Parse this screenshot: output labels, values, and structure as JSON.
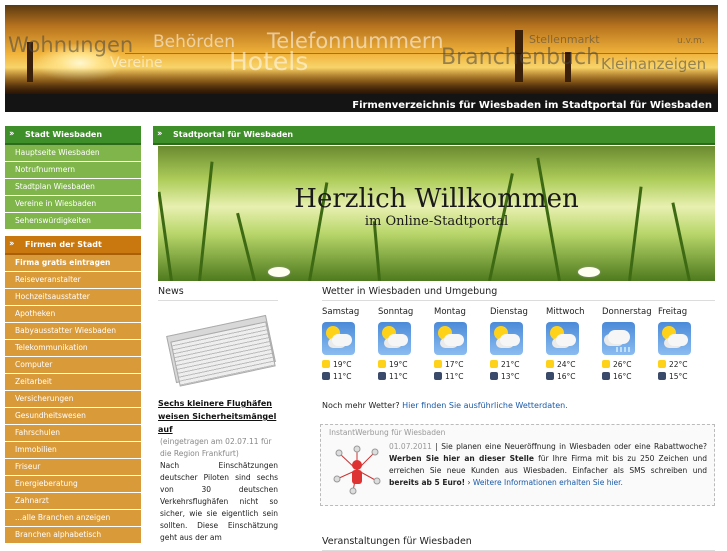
{
  "banner": {
    "words": [
      "Wohnungen",
      "Behörden",
      "Telefonnummern",
      "Vereine",
      "Hotels",
      "Branchenbuch",
      "Stellenmarkt",
      "u.v.m.",
      "Kleinanzeigen"
    ],
    "tagline": "Firmenverzeichnis für Wiesbaden im Stadtportal für Wiesbaden"
  },
  "sidebar": {
    "city": {
      "title": "Stadt Wiesbaden",
      "items": [
        "Hauptseite Wiesbaden",
        "Notrufnummern",
        "Stadtplan Wiesbaden",
        "Vereine in Wiesbaden",
        "Sehenswürdigkeiten"
      ]
    },
    "companies": {
      "title": "Firmen der Stadt",
      "items": [
        "Firma gratis eintragen",
        "Reiseveranstalter",
        "Hochzeitsausstatter",
        "Apotheken",
        "Babyausstatter Wiesbaden",
        "Telekommunikation",
        "Computer",
        "Zeitarbeit",
        "Versicherungen",
        "Gesundheitswesen",
        "Fahrschulen",
        "Immobilien",
        "Friseur",
        "Energieberatung",
        "Zahnarzt",
        "...alle Branchen anzeigen",
        "Branchen alphabetisch"
      ]
    }
  },
  "main": {
    "title": "Stadtportal für Wiesbaden",
    "hero_title": "Herzlich Willkommen",
    "hero_subtitle": "im Online-Stadtportal"
  },
  "news": {
    "title": "News",
    "headline": "Sechs kleinere Flughäfen weisen Sicherheitsmängel auf",
    "meta": "(eingetragen am 02.07.11 für die Region Frankfurt)",
    "body": "Nach Einschätzungen deutscher Piloten sind sechs von 30 deutschen Verkehrsflughäfen nicht so sicher, wie sie eigentlich sein sollten. Diese Einschätzung geht aus der am"
  },
  "weather": {
    "title": "Wetter in Wiesbaden und Umgebung",
    "days": [
      {
        "name": "Samstag",
        "icon": "sun-cloud-icon",
        "high": "19°C",
        "low": "11°C"
      },
      {
        "name": "Sonntag",
        "icon": "sun-cloud-icon",
        "high": "19°C",
        "low": "11°C"
      },
      {
        "name": "Montag",
        "icon": "sun-cloud-icon",
        "high": "17°C",
        "low": "11°C"
      },
      {
        "name": "Dienstag",
        "icon": "sun-cloud-icon",
        "high": "21°C",
        "low": "13°C"
      },
      {
        "name": "Mittwoch",
        "icon": "sun-cloud-icon",
        "high": "24°C",
        "low": "16°C"
      },
      {
        "name": "Donnerstag",
        "icon": "rain-cloud-icon",
        "high": "26°C",
        "low": "16°C"
      },
      {
        "name": "Freitag",
        "icon": "sun-cloud-icon",
        "high": "22°C",
        "low": "15°C"
      }
    ],
    "more_text": "Noch mehr Wetter?",
    "more_link": "Hier finden Sie ausführliche Wetterdaten."
  },
  "ad": {
    "label": "InstantWerbung für Wiesbaden",
    "date": "01.07.2011",
    "sep": " | ",
    "text1": "Sie planen eine Neueröffnung in Wiesbaden oder eine Rabattwoche?",
    "bold1": "Werben Sie hier an dieser Stelle",
    "text2": "für Ihre Firma mit bis zu 250 Zeichen und erreichen Sie neue Kunden aus Wiesbaden. Einfacher als SMS schreiben und",
    "bold2": "bereits ab 5 Euro!",
    "link": "Weitere Informationen erhalten Sie hier."
  },
  "events": {
    "title": "Veranstaltungen für Wiesbaden"
  }
}
